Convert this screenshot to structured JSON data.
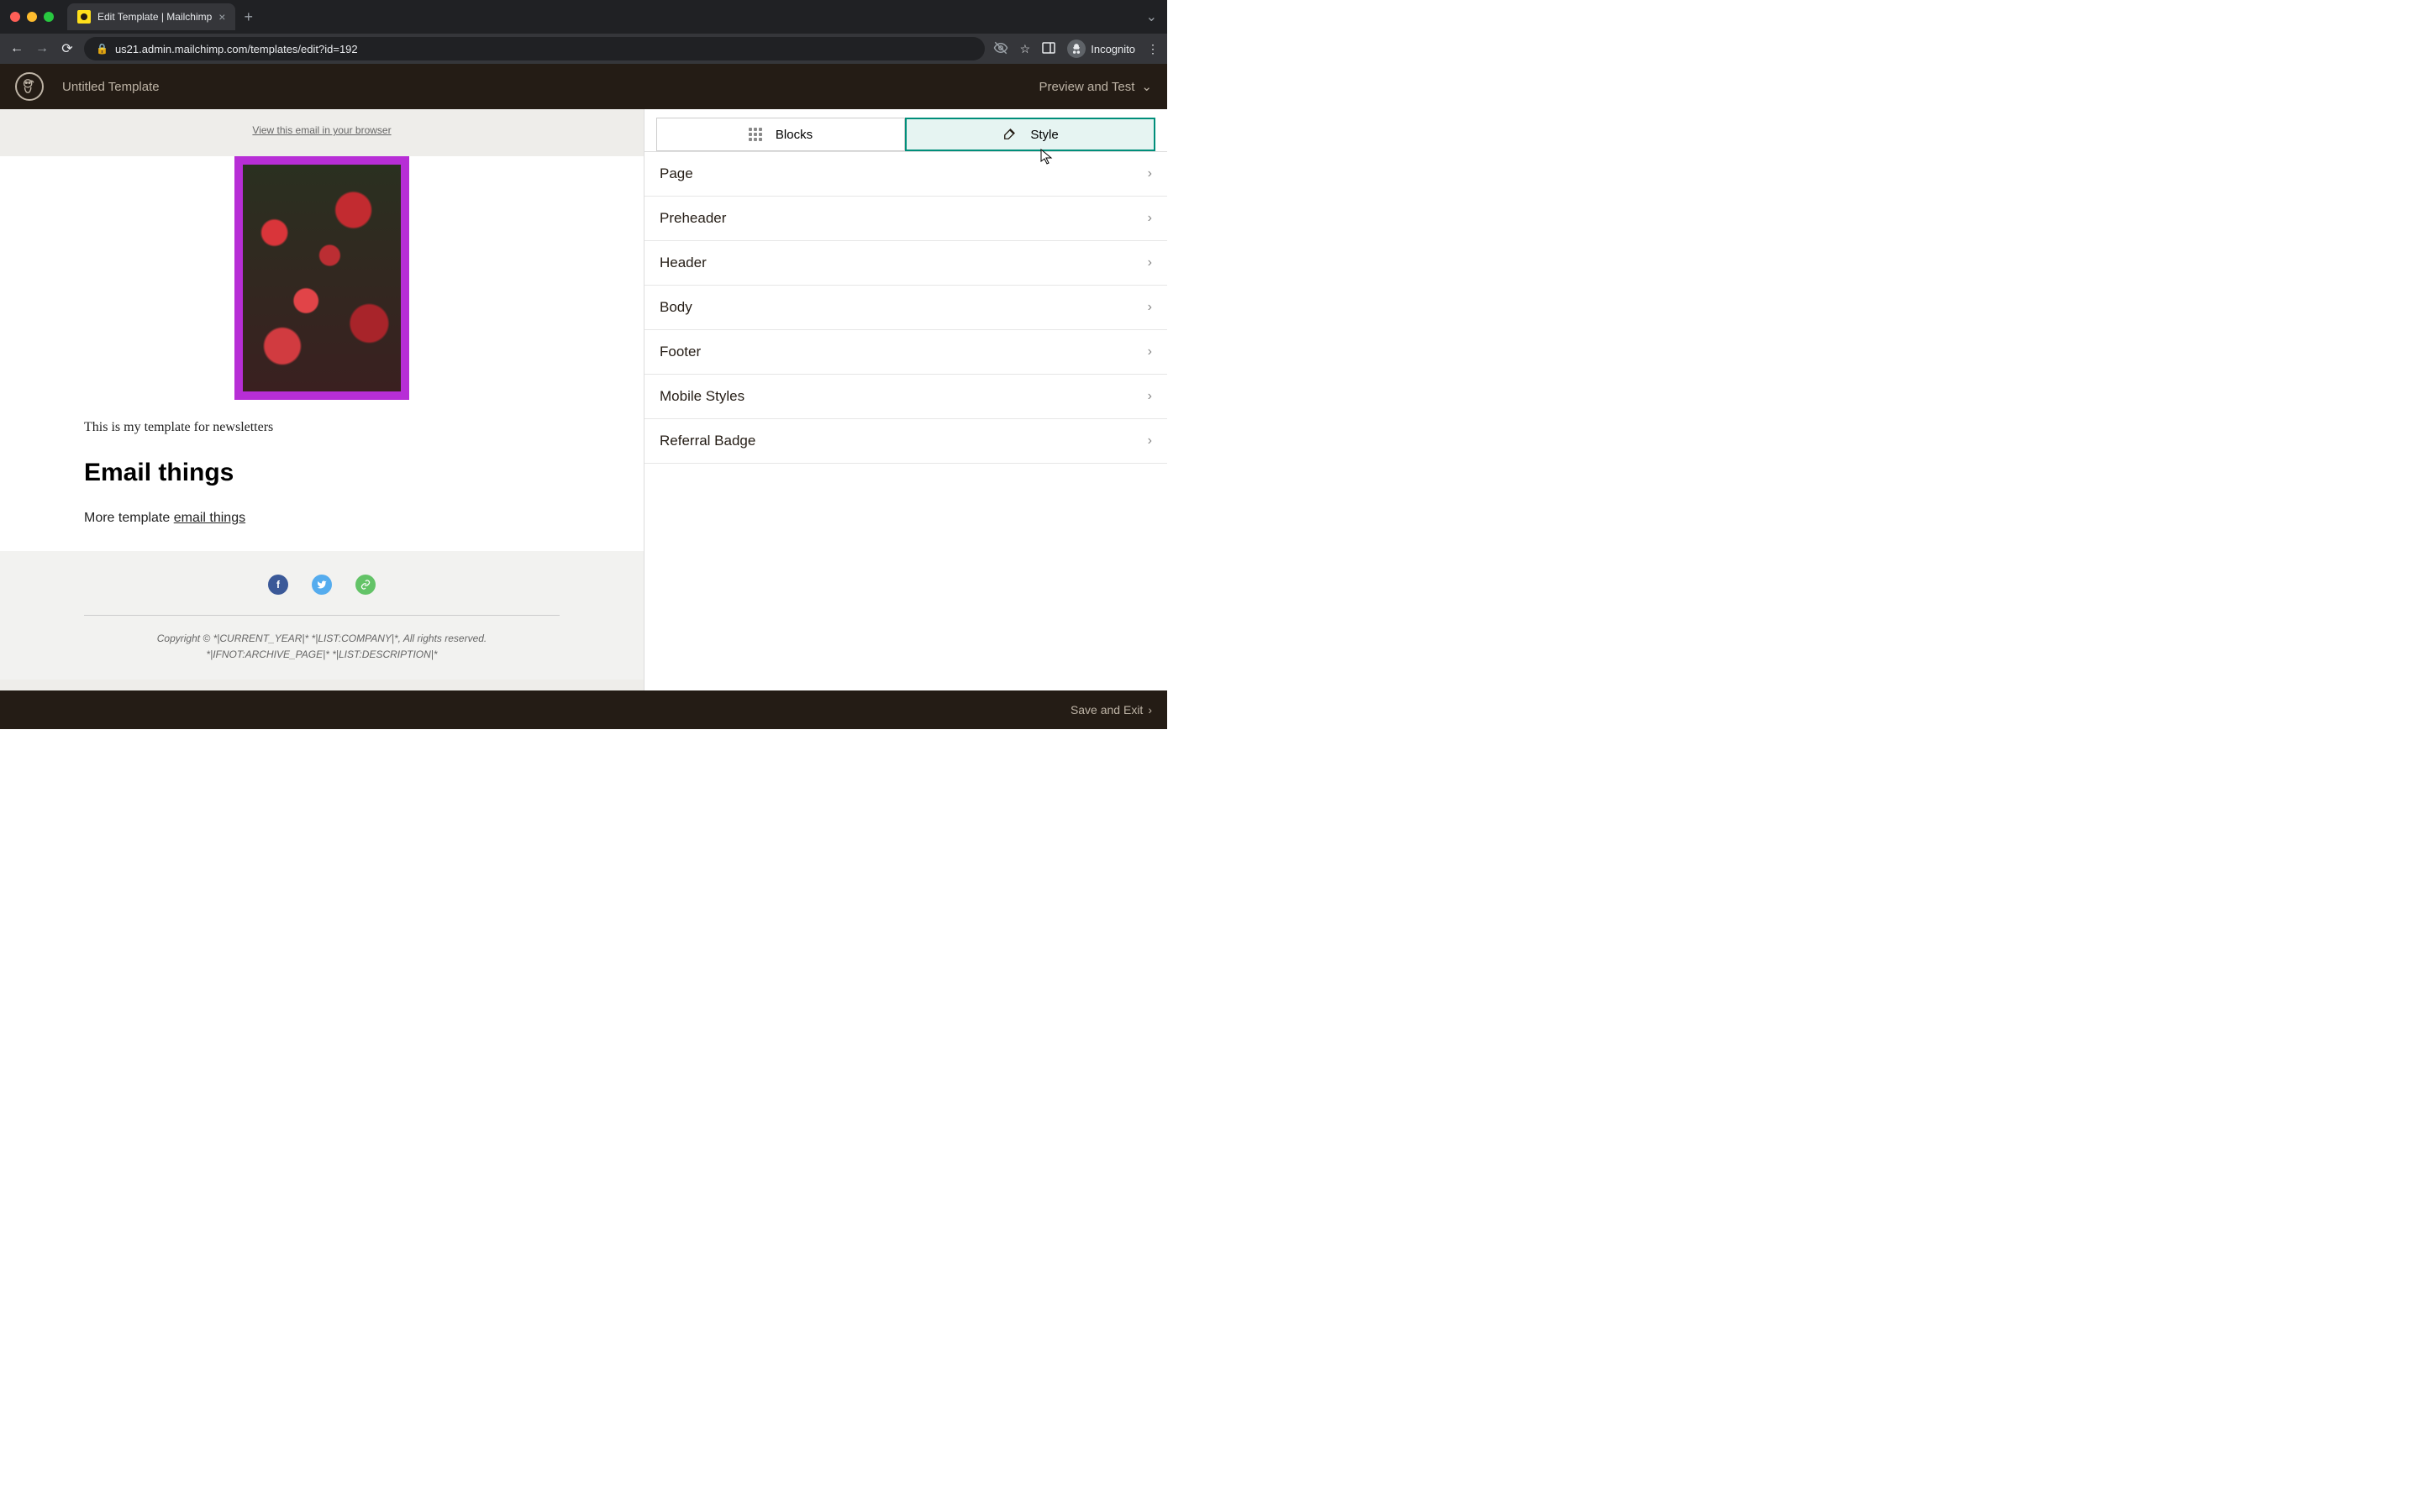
{
  "browser": {
    "tab_title": "Edit Template | Mailchimp",
    "url": "us21.admin.mailchimp.com/templates/edit?id=192",
    "incognito_label": "Incognito"
  },
  "header": {
    "template_name": "Untitled Template",
    "preview_label": "Preview and Test"
  },
  "canvas": {
    "view_browser": "View this email in your browser",
    "newsletter_line": "This is my template for newsletters",
    "heading": "Email things",
    "more_prefix": "More template ",
    "more_link": "email things",
    "copyright_line1": "Copyright © *|CURRENT_YEAR|* *|LIST:COMPANY|*, All rights reserved.",
    "copyright_line2": "*|IFNOT:ARCHIVE_PAGE|* *|LIST:DESCRIPTION|*"
  },
  "panel": {
    "tabs": {
      "blocks": "Blocks",
      "style": "Style",
      "active": "style"
    },
    "sections": [
      {
        "label": "Page"
      },
      {
        "label": "Preheader"
      },
      {
        "label": "Header"
      },
      {
        "label": "Body"
      },
      {
        "label": "Footer"
      },
      {
        "label": "Mobile Styles"
      },
      {
        "label": "Referral Badge"
      }
    ]
  },
  "footer_bar": {
    "save_exit": "Save and Exit"
  }
}
